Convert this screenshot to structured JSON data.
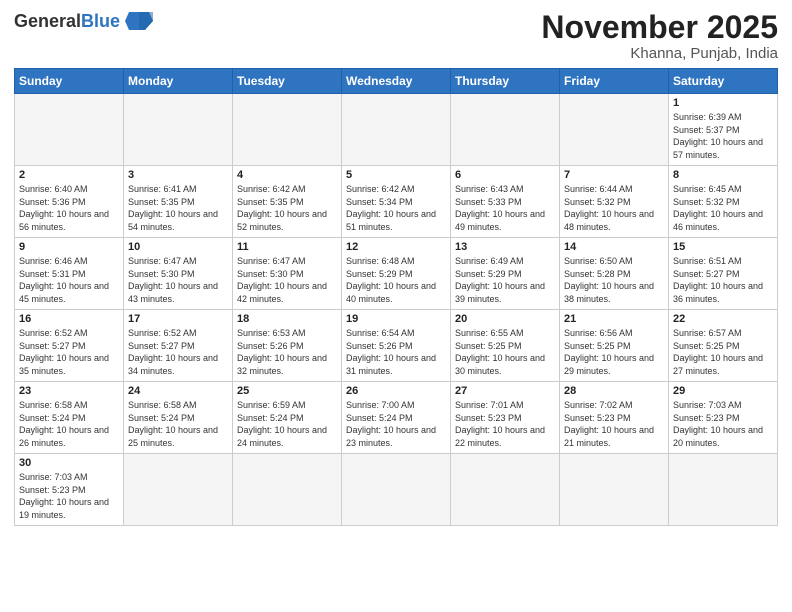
{
  "header": {
    "logo_general": "General",
    "logo_blue": "Blue",
    "month_title": "November 2025",
    "location": "Khanna, Punjab, India"
  },
  "weekdays": [
    "Sunday",
    "Monday",
    "Tuesday",
    "Wednesday",
    "Thursday",
    "Friday",
    "Saturday"
  ],
  "weeks": [
    [
      {
        "day": "",
        "info": ""
      },
      {
        "day": "",
        "info": ""
      },
      {
        "day": "",
        "info": ""
      },
      {
        "day": "",
        "info": ""
      },
      {
        "day": "",
        "info": ""
      },
      {
        "day": "",
        "info": ""
      },
      {
        "day": "1",
        "info": "Sunrise: 6:39 AM\nSunset: 5:37 PM\nDaylight: 10 hours and 57 minutes."
      }
    ],
    [
      {
        "day": "2",
        "info": "Sunrise: 6:40 AM\nSunset: 5:36 PM\nDaylight: 10 hours and 56 minutes."
      },
      {
        "day": "3",
        "info": "Sunrise: 6:41 AM\nSunset: 5:35 PM\nDaylight: 10 hours and 54 minutes."
      },
      {
        "day": "4",
        "info": "Sunrise: 6:42 AM\nSunset: 5:35 PM\nDaylight: 10 hours and 52 minutes."
      },
      {
        "day": "5",
        "info": "Sunrise: 6:42 AM\nSunset: 5:34 PM\nDaylight: 10 hours and 51 minutes."
      },
      {
        "day": "6",
        "info": "Sunrise: 6:43 AM\nSunset: 5:33 PM\nDaylight: 10 hours and 49 minutes."
      },
      {
        "day": "7",
        "info": "Sunrise: 6:44 AM\nSunset: 5:32 PM\nDaylight: 10 hours and 48 minutes."
      },
      {
        "day": "8",
        "info": "Sunrise: 6:45 AM\nSunset: 5:32 PM\nDaylight: 10 hours and 46 minutes."
      }
    ],
    [
      {
        "day": "9",
        "info": "Sunrise: 6:46 AM\nSunset: 5:31 PM\nDaylight: 10 hours and 45 minutes."
      },
      {
        "day": "10",
        "info": "Sunrise: 6:47 AM\nSunset: 5:30 PM\nDaylight: 10 hours and 43 minutes."
      },
      {
        "day": "11",
        "info": "Sunrise: 6:47 AM\nSunset: 5:30 PM\nDaylight: 10 hours and 42 minutes."
      },
      {
        "day": "12",
        "info": "Sunrise: 6:48 AM\nSunset: 5:29 PM\nDaylight: 10 hours and 40 minutes."
      },
      {
        "day": "13",
        "info": "Sunrise: 6:49 AM\nSunset: 5:29 PM\nDaylight: 10 hours and 39 minutes."
      },
      {
        "day": "14",
        "info": "Sunrise: 6:50 AM\nSunset: 5:28 PM\nDaylight: 10 hours and 38 minutes."
      },
      {
        "day": "15",
        "info": "Sunrise: 6:51 AM\nSunset: 5:27 PM\nDaylight: 10 hours and 36 minutes."
      }
    ],
    [
      {
        "day": "16",
        "info": "Sunrise: 6:52 AM\nSunset: 5:27 PM\nDaylight: 10 hours and 35 minutes."
      },
      {
        "day": "17",
        "info": "Sunrise: 6:52 AM\nSunset: 5:27 PM\nDaylight: 10 hours and 34 minutes."
      },
      {
        "day": "18",
        "info": "Sunrise: 6:53 AM\nSunset: 5:26 PM\nDaylight: 10 hours and 32 minutes."
      },
      {
        "day": "19",
        "info": "Sunrise: 6:54 AM\nSunset: 5:26 PM\nDaylight: 10 hours and 31 minutes."
      },
      {
        "day": "20",
        "info": "Sunrise: 6:55 AM\nSunset: 5:25 PM\nDaylight: 10 hours and 30 minutes."
      },
      {
        "day": "21",
        "info": "Sunrise: 6:56 AM\nSunset: 5:25 PM\nDaylight: 10 hours and 29 minutes."
      },
      {
        "day": "22",
        "info": "Sunrise: 6:57 AM\nSunset: 5:25 PM\nDaylight: 10 hours and 27 minutes."
      }
    ],
    [
      {
        "day": "23",
        "info": "Sunrise: 6:58 AM\nSunset: 5:24 PM\nDaylight: 10 hours and 26 minutes."
      },
      {
        "day": "24",
        "info": "Sunrise: 6:58 AM\nSunset: 5:24 PM\nDaylight: 10 hours and 25 minutes."
      },
      {
        "day": "25",
        "info": "Sunrise: 6:59 AM\nSunset: 5:24 PM\nDaylight: 10 hours and 24 minutes."
      },
      {
        "day": "26",
        "info": "Sunrise: 7:00 AM\nSunset: 5:24 PM\nDaylight: 10 hours and 23 minutes."
      },
      {
        "day": "27",
        "info": "Sunrise: 7:01 AM\nSunset: 5:23 PM\nDaylight: 10 hours and 22 minutes."
      },
      {
        "day": "28",
        "info": "Sunrise: 7:02 AM\nSunset: 5:23 PM\nDaylight: 10 hours and 21 minutes."
      },
      {
        "day": "29",
        "info": "Sunrise: 7:03 AM\nSunset: 5:23 PM\nDaylight: 10 hours and 20 minutes."
      }
    ],
    [
      {
        "day": "30",
        "info": "Sunrise: 7:03 AM\nSunset: 5:23 PM\nDaylight: 10 hours and 19 minutes."
      },
      {
        "day": "",
        "info": ""
      },
      {
        "day": "",
        "info": ""
      },
      {
        "day": "",
        "info": ""
      },
      {
        "day": "",
        "info": ""
      },
      {
        "day": "",
        "info": ""
      },
      {
        "day": "",
        "info": ""
      }
    ]
  ]
}
